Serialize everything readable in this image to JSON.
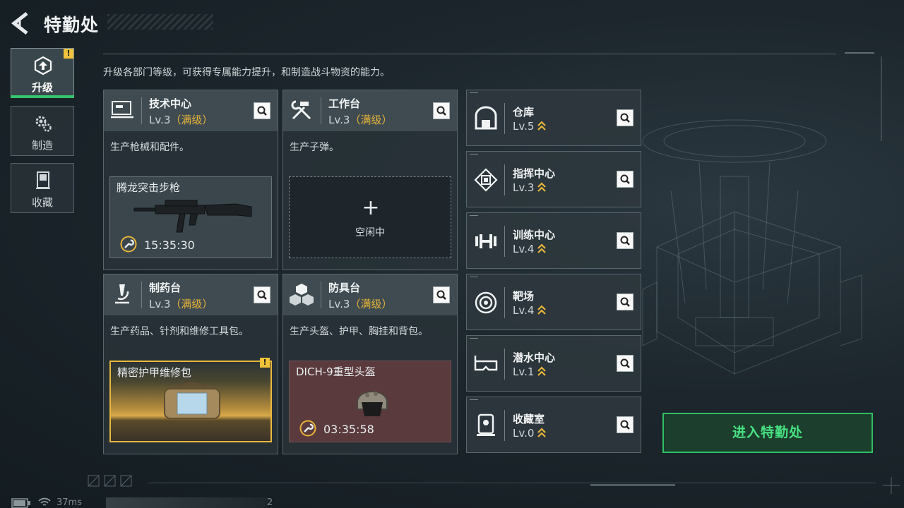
{
  "header": {
    "title": "特勤处"
  },
  "description": "升级各部门等级，可获得专属能力提升，和制造战斗物资的能力。",
  "nav": [
    {
      "label": "升级",
      "icon": "upgrade-icon",
      "active": true,
      "warning": "!"
    },
    {
      "label": "制造",
      "icon": "gears-icon",
      "active": false
    },
    {
      "label": "收藏",
      "icon": "collection-icon",
      "active": false
    }
  ],
  "cards": [
    {
      "name": "技术中心",
      "level": "Lv.3",
      "max": "（满级）",
      "desc": "生产枪械和配件。",
      "slot": {
        "state": "producing",
        "item": "腾龙突击步枪",
        "timer": "15:35:30"
      }
    },
    {
      "name": "工作台",
      "level": "Lv.3",
      "max": "（满级）",
      "desc": "生产子弹。",
      "slot": {
        "state": "idle",
        "label": "空闲中"
      }
    },
    {
      "name": "制药台",
      "level": "Lv.3",
      "max": "（满级）",
      "desc": "生产药品、针剂和维修工具包。",
      "slot": {
        "state": "done",
        "item": "精密护甲维修包",
        "warning": "!"
      }
    },
    {
      "name": "防具台",
      "level": "Lv.3",
      "max": "（满级）",
      "desc": "生产头盔、护甲、胸挂和背包。",
      "slot": {
        "state": "producing",
        "item": "DICH-9重型头盔",
        "timer": "03:35:58"
      }
    }
  ],
  "facilities": [
    {
      "name": "仓库",
      "level": "Lv.5",
      "icon": "warehouse-icon"
    },
    {
      "name": "指挥中心",
      "level": "Lv.3",
      "icon": "chip-icon"
    },
    {
      "name": "训练中心",
      "level": "Lv.4",
      "icon": "dumbbell-icon"
    },
    {
      "name": "靶场",
      "level": "Lv.4",
      "icon": "target-icon"
    },
    {
      "name": "潜水中心",
      "level": "Lv.1",
      "icon": "diving-mask-icon"
    },
    {
      "name": "收藏室",
      "level": "Lv.0",
      "icon": "collection-room-icon"
    }
  ],
  "enter_button": "进入特勤处",
  "status": {
    "ping": "37ms",
    "extra": "2"
  },
  "colors": {
    "accent_green": "#35c46c",
    "max_level": "#e8b43a",
    "warning": "#f0c23a"
  }
}
